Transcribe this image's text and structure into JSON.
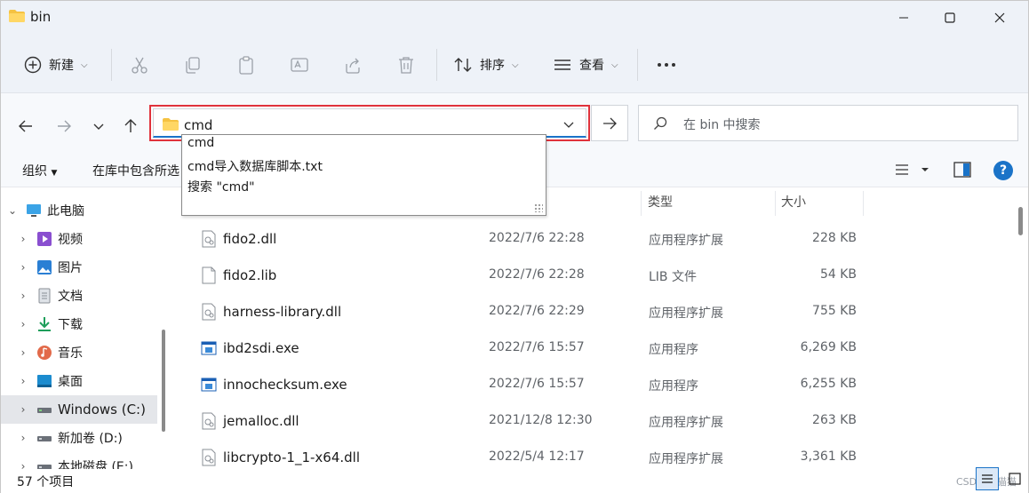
{
  "window": {
    "title": "bin"
  },
  "commandbar": {
    "new_label": "新建",
    "sort_label": "排序",
    "view_label": "查看"
  },
  "address": {
    "value": "cmd"
  },
  "search": {
    "placeholder": "在 bin 中搜索"
  },
  "subbar": {
    "organize_label": "组织",
    "include_label": "在库中包含所选"
  },
  "autocomplete": {
    "items": [
      "cmd",
      "cmd导入数据库脚本.txt",
      "搜索 \"cmd\""
    ]
  },
  "sidebar": {
    "items": [
      {
        "label": "此电脑",
        "icon": "pc-icon",
        "expanded": true
      },
      {
        "label": "视频",
        "icon": "video-icon"
      },
      {
        "label": "图片",
        "icon": "pictures-icon"
      },
      {
        "label": "文档",
        "icon": "documents-icon"
      },
      {
        "label": "下载",
        "icon": "download-icon"
      },
      {
        "label": "音乐",
        "icon": "music-icon"
      },
      {
        "label": "桌面",
        "icon": "desktop-icon"
      },
      {
        "label": "Windows (C:)",
        "icon": "drive-icon",
        "selected": true
      },
      {
        "label": "新加卷 (D:)",
        "icon": "drive-icon"
      },
      {
        "label": "本地磁盘 (E:)",
        "icon": "drive-icon"
      }
    ]
  },
  "list": {
    "columns": {
      "type": "类型",
      "size": "大小"
    },
    "rows": [
      {
        "name": "fido2.dll",
        "date": "2022/7/6 22:28",
        "type": "应用程序扩展",
        "size": "228 KB",
        "icon": "dll-file-icon"
      },
      {
        "name": "fido2.lib",
        "date": "2022/7/6 22:28",
        "type": "LIB 文件",
        "size": "54 KB",
        "icon": "file-icon"
      },
      {
        "name": "harness-library.dll",
        "date": "2022/7/6 22:29",
        "type": "应用程序扩展",
        "size": "755 KB",
        "icon": "dll-file-icon"
      },
      {
        "name": "ibd2sdi.exe",
        "date": "2022/7/6 15:57",
        "type": "应用程序",
        "size": "6,269 KB",
        "icon": "exe-file-icon"
      },
      {
        "name": "innochecksum.exe",
        "date": "2022/7/6 15:57",
        "type": "应用程序",
        "size": "6,255 KB",
        "icon": "exe-file-icon"
      },
      {
        "name": "jemalloc.dll",
        "date": "2021/12/8 12:30",
        "type": "应用程序扩展",
        "size": "263 KB",
        "icon": "dll-file-icon"
      },
      {
        "name": "libcrypto-1_1-x64.dll",
        "date": "2022/5/4 12:17",
        "type": "应用程序扩展",
        "size": "3,361 KB",
        "icon": "dll-file-icon"
      }
    ]
  },
  "status": {
    "count": "57 个项目",
    "watermark": "CSDN @猫猫"
  },
  "colors": {
    "accent": "#1a73c8",
    "highlight_border": "#e0323c",
    "folder": "#f5c242"
  }
}
